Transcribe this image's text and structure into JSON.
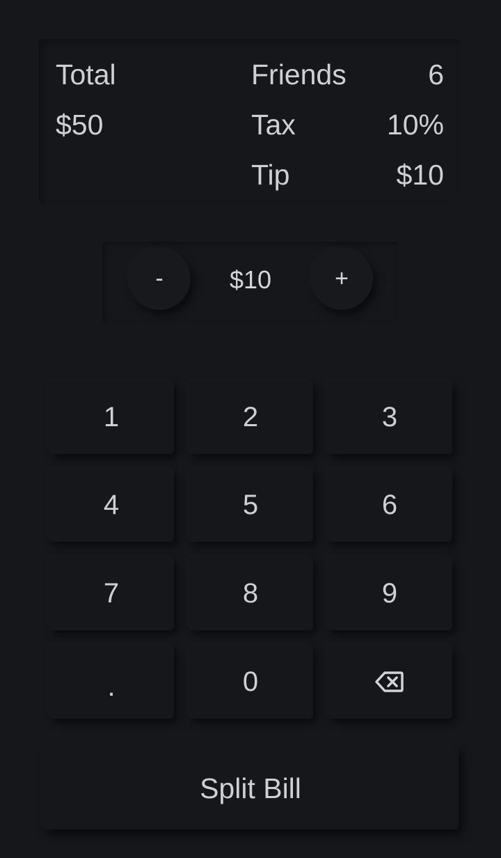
{
  "summary": {
    "total_label": "Total",
    "total_value": "$50",
    "friends_label": "Friends",
    "friends_value": "6",
    "tax_label": "Tax",
    "tax_value": "10%",
    "tip_label": "Tip",
    "tip_value": "$10"
  },
  "tip_stepper": {
    "decrement_label": "-",
    "value": "$10",
    "increment_label": "+"
  },
  "keypad": {
    "keys": [
      "1",
      "2",
      "3",
      "4",
      "5",
      "6",
      "7",
      "8",
      "9",
      ".",
      "0"
    ],
    "backspace_icon": "backspace-icon"
  },
  "action": {
    "split_label": "Split Bill"
  },
  "colors": {
    "background": "#16171b",
    "text": "#cfd0d3"
  }
}
